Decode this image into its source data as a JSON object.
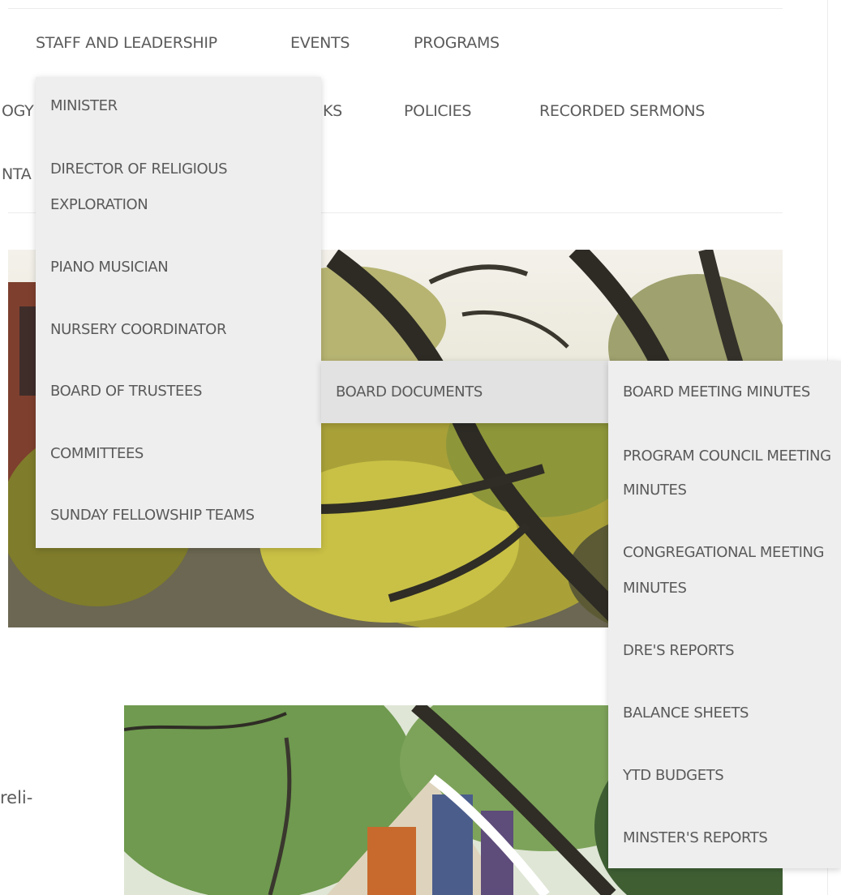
{
  "nav": {
    "row1": [
      "STAFF AND LEADERSHIP",
      "EVENTS",
      "PROGRAMS"
    ],
    "row2": [
      "OGY",
      "KS",
      "POLICIES",
      "RECORDED SERMONS"
    ],
    "row3": [
      "NTA"
    ]
  },
  "staff_menu": {
    "items": [
      "MINISTER",
      "DIRECTOR OF RELIGIOUS",
      "EXPLORATION",
      "PIANO MUSICIAN",
      "NURSERY COORDINATOR",
      "BOARD OF TRUSTEES",
      "COMMITTEES",
      "SUNDAY FELLOWSHIP TEAMS"
    ]
  },
  "trustees_menu": {
    "items": [
      "BOARD DOCUMENTS"
    ]
  },
  "documents_menu": {
    "items": [
      "BOARD MEETING MINUTES",
      "PROGRAM COUNCIL MEETING",
      "MINUTES",
      "CONGREGATIONAL MEETING",
      "MINUTES",
      "DRE'S REPORTS",
      "BALANCE SHEETS",
      "YTD BUDGETS",
      "MINSTER'S REPORTS"
    ]
  },
  "body": {
    "fragment": "reli-"
  },
  "colors": {
    "menu_bg": "#eeeeee",
    "menu_highlight": "#e2e2e2",
    "text": "#5a5a5a"
  }
}
